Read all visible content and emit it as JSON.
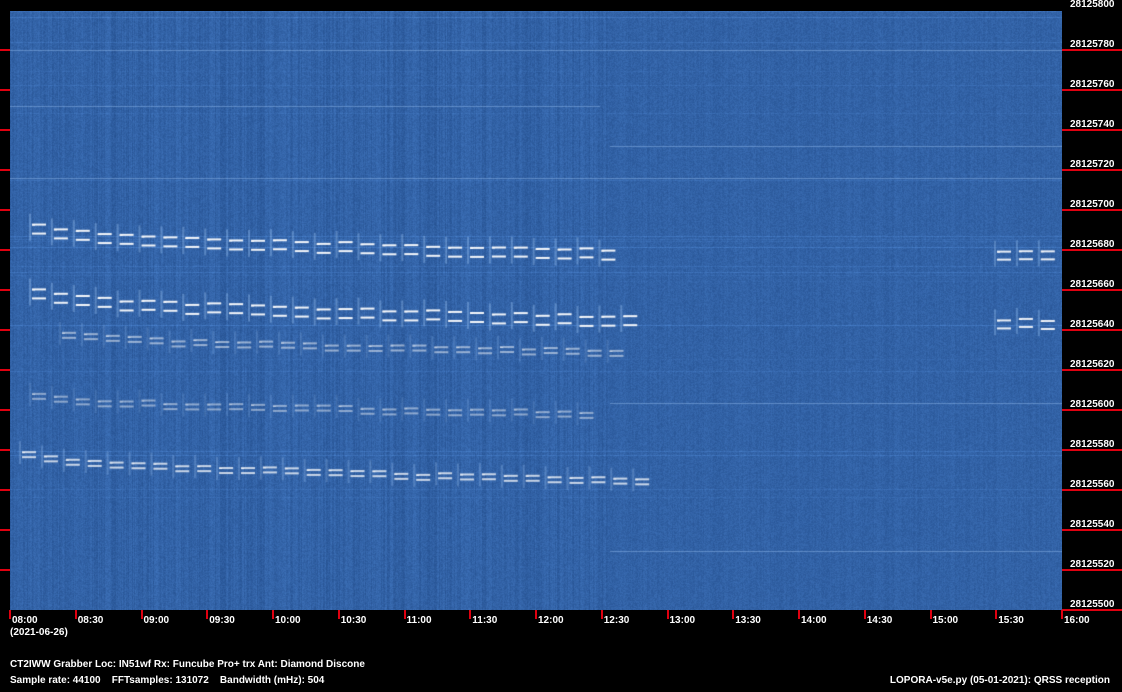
{
  "chart_data": {
    "type": "heatmap",
    "title": "",
    "xlabel": "",
    "ylabel": "",
    "x_ticks": [
      "08:00",
      "08:30",
      "09:00",
      "09:30",
      "10:00",
      "10:30",
      "11:00",
      "11:30",
      "12:00",
      "12:30",
      "13:00",
      "13:30",
      "14:00",
      "14:30",
      "15:00",
      "15:30",
      "16:00"
    ],
    "x_date": "(2021-06-26)",
    "xlim": [
      "08:00",
      "16:00"
    ],
    "y_ticks": [
      "28125800",
      "28125780",
      "28125760",
      "28125740",
      "28125720",
      "28125700",
      "28125680",
      "28125660",
      "28125640",
      "28125620",
      "28125600",
      "28125580",
      "28125560",
      "28125540",
      "28125520",
      "28125500"
    ],
    "ylim": [
      28125500,
      28125800
    ],
    "colors": {
      "background": "#3563a6",
      "signal": "#ffffff",
      "tick": "#e00010"
    }
  },
  "footer": {
    "station": "CT2IWW Grabber Loc: IN51wf Rx: Funcube Pro+ trx Ant: Diamond Discone",
    "params": "Sample rate: 44100    FFTsamples: 131072    Bandwidth (mHz): 504",
    "software": "LOPORA-v5e.py (05-01-2021): QRSS reception"
  }
}
